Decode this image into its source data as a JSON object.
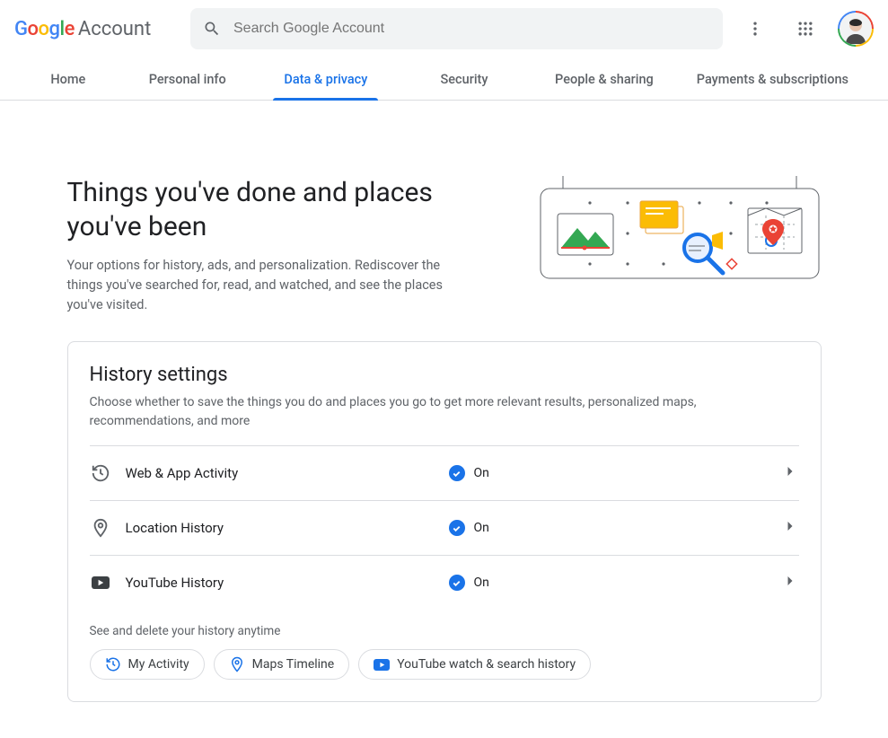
{
  "brand": {
    "name": "Google",
    "product": "Account"
  },
  "search": {
    "placeholder": "Search Google Account"
  },
  "tabs": [
    {
      "label": "Home"
    },
    {
      "label": "Personal info"
    },
    {
      "label": "Data & privacy"
    },
    {
      "label": "Security"
    },
    {
      "label": "People & sharing"
    },
    {
      "label": "Payments & subscriptions"
    }
  ],
  "hero": {
    "title": "Things you've done and places you've been",
    "subtitle": "Your options for history, ads, and personalization. Rediscover the things you've searched for, read, and watched, and see the places you've visited."
  },
  "historyCard": {
    "title": "History settings",
    "subtitle": "Choose whether to save the things you do and places you go to get more relevant results, personalized maps, recommendations, and more",
    "rows": [
      {
        "label": "Web & App Activity",
        "status": "On"
      },
      {
        "label": "Location History",
        "status": "On"
      },
      {
        "label": "YouTube History",
        "status": "On"
      }
    ],
    "note": "See and delete your history anytime",
    "chips": [
      {
        "label": "My Activity"
      },
      {
        "label": "Maps Timeline"
      },
      {
        "label": "YouTube watch & search history"
      }
    ]
  }
}
